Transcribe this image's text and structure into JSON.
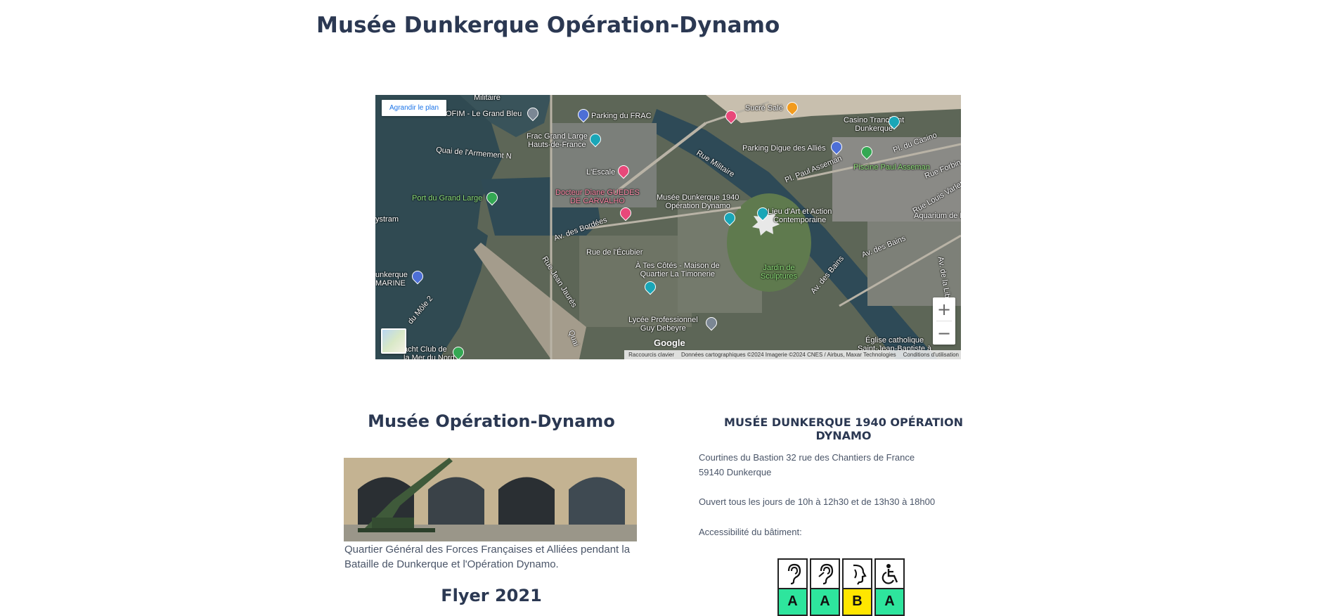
{
  "page": {
    "title": "Musée Dunkerque Opération-Dynamo"
  },
  "map": {
    "enlarge_label": "Agrandir le plan",
    "zoom_in_label": "+",
    "zoom_out_label": "−",
    "logo_text": "Google",
    "attribution": {
      "shortcuts": "Raccourcis clavier",
      "data": "Données cartographiques ©2024 Imagerie ©2024 CNES / Airbus, Maxar Technologies",
      "terms": "Conditions d'utilisation"
    },
    "labels": {
      "militaire": "Militaire",
      "ofim": "OFIM - Le Grand Bleu",
      "parking_frac": "Parking du FRAC",
      "frac": "Frac Grand Large\nHauts-de-France",
      "quai_armement": "Quai de l'Armement N",
      "lescale": "L'Escale",
      "port_grand_large": "Port du Grand Large",
      "docteur": "Docteur Diane GUEDES\nDE CARVALHO",
      "musee": "Musée Dunkerque 1940\nOpération Dynamo",
      "lieu_art": "Lieu d'Art et Action\nContemporaine",
      "sucre_sale": "Sucré Salé",
      "casino": "Casino Tranchant\nDunkerque",
      "parking_digue": "Parking Digue des Alliés",
      "piscine": "Piscine Paul Asseman",
      "rue_militaire": "Rue Militaire",
      "pl_paul_asseman": "Pl. Paul Asseman",
      "pl_du_casino": "Pl. du Casino",
      "rue_forbin": "Rue Forbin",
      "rue_louis_varlet": "Rue Louis Varlet",
      "aquarium": "Aquarium de Dunk",
      "av_bordees": "Av. des Bordées",
      "rue_ecubier": "Rue de l'Écubier",
      "maison_quartier": "À Tes Côtés - Maison de\nQuartier La Timonerie",
      "jardin": "Jardin de\nSculptures",
      "av_bains": "Av. des Bains",
      "av_bains_2": "Av. des Bains",
      "ystram": "ystram",
      "dunkerque_marine": "unkerque\nMARINE",
      "lycee": "Lycée Professionnel\nGuy Debeyre",
      "eglise": "Église catholique\nSaint-Jean-Baptiste à",
      "yacht_club": "acht Club de\nla Mer du Nord",
      "rue_jean_jaures": "Rue Jean Jaurès",
      "mole": "du Môle 2",
      "quai": "Quai",
      "av_de_la_liberation": "Av. de la Libération"
    }
  },
  "left_column": {
    "title": "Musée Opération-Dynamo",
    "caption": "Quartier Général des Forces Françaises et Alliées pendant la Bataille de Dunkerque et l'Opération Dynamo.",
    "flyer_title": "Flyer 2021"
  },
  "right_column": {
    "heading": "MUSÉE DUNKERQUE 1940 OPÉRATION DYNAMO",
    "address_line1": "Courtines du Bastion 32 rue des Chantiers de France",
    "address_line2": "59140 Dunkerque",
    "hours": "Ouvert tous les jours de 10h à 12h30 et de 13h30 à 18h00",
    "accessibility_label": "Accessibilité du bâtiment:",
    "accessibility": [
      {
        "icon": "ear-icon",
        "grade": "A",
        "color": "#2ee59d"
      },
      {
        "icon": "ear-icon",
        "grade": "A",
        "color": "#2ee59d"
      },
      {
        "icon": "head-profile-icon",
        "grade": "B",
        "color": "#ffe600"
      },
      {
        "icon": "wheelchair-icon",
        "grade": "A",
        "color": "#2ee59d"
      }
    ]
  }
}
